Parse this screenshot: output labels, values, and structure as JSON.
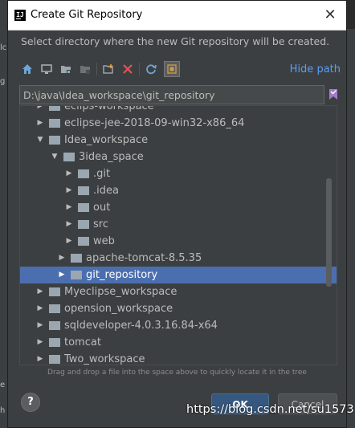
{
  "window": {
    "title": "Create Git Repository",
    "close_glyph": "✕"
  },
  "background": {
    "fragment_1": "lc",
    "fragment_2": "g",
    "fragment_3": "e",
    "fragment_4": "h"
  },
  "description": "Select directory where the new Git repository will be created.",
  "toolbar": {
    "icons": [
      "home-icon",
      "desktop-icon",
      "project-folder-icon",
      "module-folder-icon",
      "new-folder-icon",
      "delete-icon",
      "refresh-icon",
      "show-hidden-icon"
    ],
    "hide_path_label": "Hide path"
  },
  "path": {
    "value": "D:\\java\\Idea_workspace\\git_repository"
  },
  "tree": {
    "nodes": [
      {
        "label": "eclips-workspace",
        "expanded": false
      },
      {
        "label": "eclipse-jee-2018-09-win32-x86_64",
        "expanded": false
      },
      {
        "label": "Idea_workspace",
        "expanded": true
      },
      {
        "label": "3idea_space",
        "expanded": true
      },
      {
        "label": ".git",
        "expanded": false
      },
      {
        "label": ".idea",
        "expanded": false
      },
      {
        "label": "out",
        "expanded": false
      },
      {
        "label": "src",
        "expanded": false
      },
      {
        "label": "web",
        "expanded": false
      },
      {
        "label": "apache-tomcat-8.5.35",
        "expanded": false
      },
      {
        "label": "git_repository",
        "expanded": false,
        "selected": true
      },
      {
        "label": "Myeclipse_workspace",
        "expanded": false
      },
      {
        "label": "opension_workspace",
        "expanded": false
      },
      {
        "label": "sqldeveloper-4.0.3.16.84-x64",
        "expanded": false
      },
      {
        "label": "tomcat",
        "expanded": false
      },
      {
        "label": "Two_workspace",
        "expanded": false
      }
    ]
  },
  "hint": "Drag and drop a file into the space above to quickly locate it in the tree",
  "buttons": {
    "help": "?",
    "ok": "OK",
    "cancel": "Cancel"
  },
  "watermark": "https://blog.csdn.net/su1573",
  "colors": {
    "selection": "#4b6eaf",
    "folder": "#9aa7b0",
    "link": "#589df6",
    "ok_button": "#365880"
  }
}
